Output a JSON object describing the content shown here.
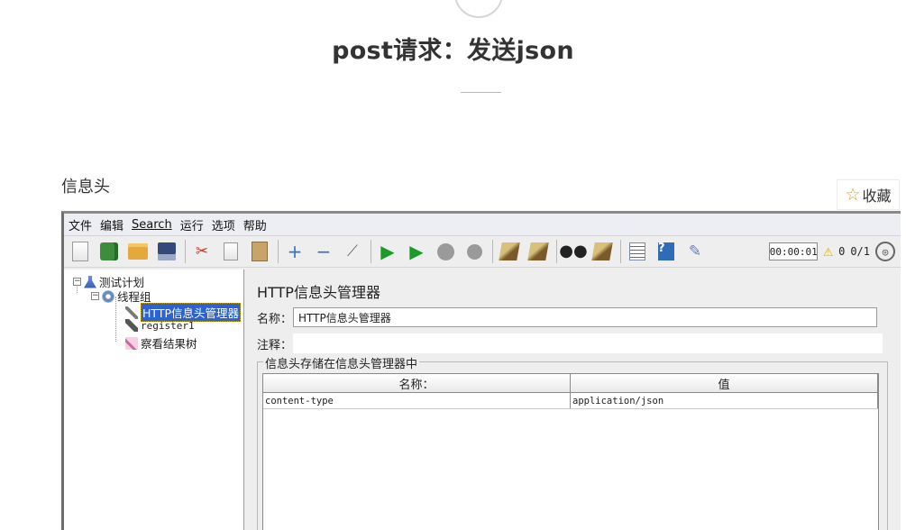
{
  "article": {
    "title": "post请求：发送json",
    "section_label": "信息头",
    "favorite_label": "收藏"
  },
  "jmeter": {
    "menu": [
      "文件",
      "编辑",
      "Search",
      "运行",
      "选项",
      "帮助"
    ],
    "timer": "00:00:01",
    "warning_count": "0",
    "thread_ratio": "0/1",
    "tree": {
      "test_plan": "测试计划",
      "thread_group": "线程组",
      "header_manager": "HTTP信息头管理器",
      "register": "register1",
      "results_tree": "察看结果树"
    },
    "panel": {
      "title": "HTTP信息头管理器",
      "name_label": "名称：",
      "name_value": "HTTP信息头管理器",
      "comment_label": "注释：",
      "comment_value": "",
      "group_legend": "信息头存储在信息头管理器中",
      "columns": [
        "名称：",
        "值"
      ],
      "rows": [
        {
          "name": "content-type",
          "value": "application/json"
        }
      ]
    }
  },
  "colors": {
    "selection": "#2c62d1",
    "run_green": "#1c9b2a",
    "favorite_star": "#e3a21a"
  }
}
